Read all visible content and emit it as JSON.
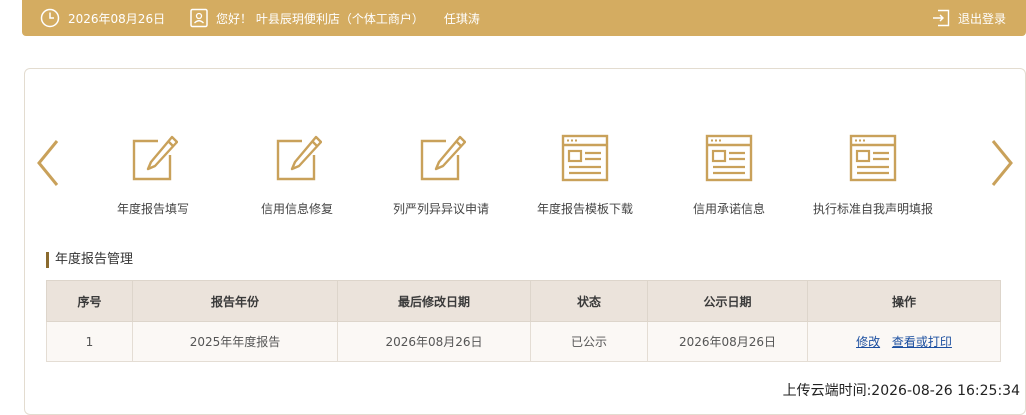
{
  "header": {
    "date": "2026年08月26日",
    "greeting": "您好！ 叶县辰玥便利店（个体工商户）",
    "user_name": "任琪涛",
    "logout_label": "退出登录"
  },
  "functions": [
    {
      "label": "年度报告填写",
      "icon": "edit-icon"
    },
    {
      "label": "信用信息修复",
      "icon": "edit-icon"
    },
    {
      "label": "列严列异异议申请",
      "icon": "edit-icon"
    },
    {
      "label": "年度报告模板下载",
      "icon": "document-window-icon"
    },
    {
      "label": "信用承诺信息",
      "icon": "document-window-icon"
    },
    {
      "label": "执行标准自我声明填报",
      "icon": "document-window-icon"
    }
  ],
  "section": {
    "title": "年度报告管理"
  },
  "table": {
    "columns": [
      "序号",
      "报告年份",
      "最后修改日期",
      "状态",
      "公示日期",
      "操作"
    ],
    "rows": [
      {
        "index": "1",
        "report_year": "2025年年度报告",
        "modified_date": "2026年08月26日",
        "status": "已公示",
        "publish_date": "2026年08月26日",
        "action_edit": "修改",
        "action_view": "查看或打印"
      }
    ]
  },
  "upload_time": "上传云端时间:2026-08-26 16:25:34",
  "colors": {
    "header_bg": "#d4ac61",
    "accent_gold": "#c9a15a",
    "table_header_bg": "#ebe3db"
  }
}
